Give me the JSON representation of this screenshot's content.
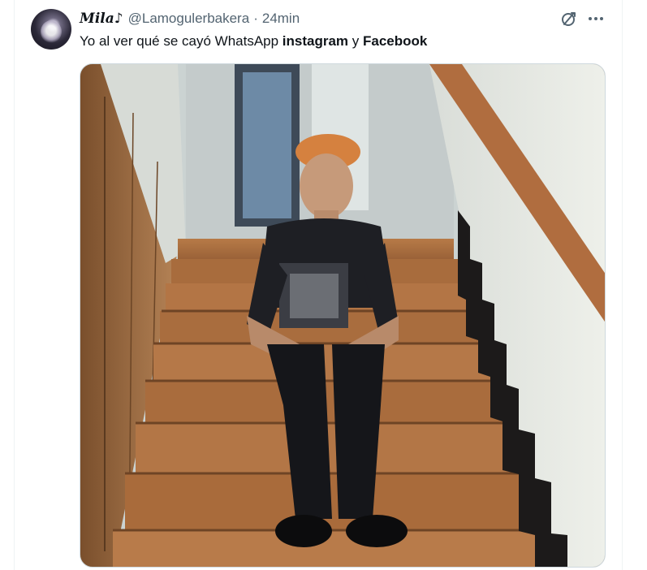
{
  "tweet": {
    "display_name": "Mila♪",
    "handle": "@Lamogulerbakera",
    "separator": "·",
    "time": "24min",
    "text_parts": {
      "part1": "Yo al ver qué se cayó WhatsApp ",
      "bold1": "instagram",
      "part2": " y ",
      "bold2": "Facebook"
    }
  },
  "icons": {
    "grok": "no-entry-slash-icon",
    "more": "more-horizontal-icon"
  },
  "media": {
    "description_label": "Tweet image"
  },
  "colors": {
    "text": "#0f1419",
    "secondary": "#536471",
    "border": "#cfd9de",
    "stair_wood": "#9a6238"
  }
}
